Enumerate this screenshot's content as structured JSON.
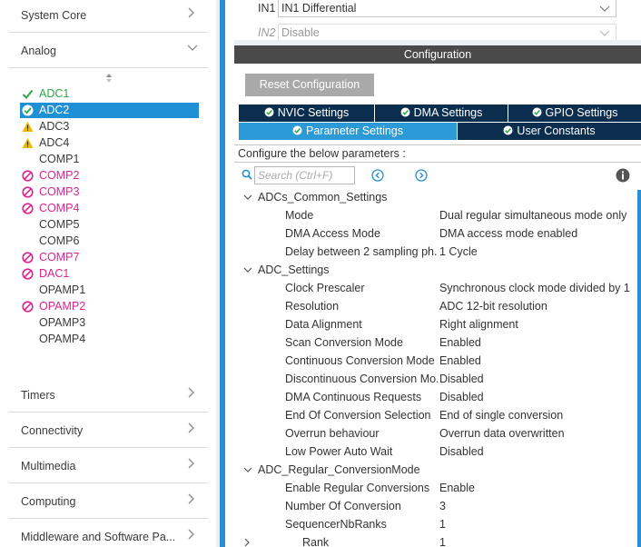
{
  "left": {
    "categories_top": [
      {
        "label": "System Core"
      },
      {
        "label": "Analog"
      }
    ],
    "peripherals": [
      {
        "name": "ADC1",
        "status": "ok",
        "color": "#2ba84a"
      },
      {
        "name": "ADC2",
        "status": "ok",
        "selected": true
      },
      {
        "name": "ADC3",
        "status": "warning"
      },
      {
        "name": "ADC4",
        "status": "warning"
      },
      {
        "name": "COMP1",
        "status": "none"
      },
      {
        "name": "COMP2",
        "status": "blocked",
        "color": "#e0228e"
      },
      {
        "name": "COMP3",
        "status": "blocked",
        "color": "#e0228e"
      },
      {
        "name": "COMP4",
        "status": "blocked",
        "color": "#e0228e"
      },
      {
        "name": "COMP5",
        "status": "none"
      },
      {
        "name": "COMP6",
        "status": "none"
      },
      {
        "name": "COMP7",
        "status": "blocked",
        "color": "#e0228e"
      },
      {
        "name": "DAC1",
        "status": "blocked",
        "color": "#e0228e"
      },
      {
        "name": "OPAMP1",
        "status": "none"
      },
      {
        "name": "OPAMP2",
        "status": "blocked",
        "color": "#e0228e"
      },
      {
        "name": "OPAMP3",
        "status": "none"
      },
      {
        "name": "OPAMP4",
        "status": "none"
      }
    ],
    "categories_bottom": [
      {
        "label": "Timers"
      },
      {
        "label": "Connectivity"
      },
      {
        "label": "Multimedia"
      },
      {
        "label": "Computing"
      },
      {
        "label": "Middleware and Software Pa..."
      }
    ]
  },
  "mode": {
    "in1": {
      "label": "IN1",
      "value": "IN1 Differential"
    },
    "in2": {
      "label": "IN2",
      "value": "Disable"
    }
  },
  "config": {
    "header": "Configuration",
    "reset_label": "Reset Configuration",
    "tabs_row1": [
      "NVIC Settings",
      "DMA Settings",
      "GPIO Settings"
    ],
    "tabs_row2": [
      "Parameter Settings",
      "User Constants"
    ],
    "active_tab": "Parameter Settings",
    "instructions": "Configure the below parameters :",
    "search_placeholder": "Search (Ctrl+F)"
  },
  "params": [
    {
      "kind": "group",
      "name": "ADCs_Common_Settings"
    },
    {
      "kind": "param",
      "name": "Mode",
      "value": "Dual regular simultaneous mode only"
    },
    {
      "kind": "param",
      "name": "DMA Access Mode",
      "value": "DMA access mode enabled"
    },
    {
      "kind": "param",
      "name": "Delay between 2 sampling ph...",
      "value": "1 Cycle"
    },
    {
      "kind": "group",
      "name": "ADC_Settings"
    },
    {
      "kind": "param",
      "name": "Clock Prescaler",
      "value": "Synchronous clock mode divided by 1"
    },
    {
      "kind": "param",
      "name": "Resolution",
      "value": "ADC 12-bit resolution"
    },
    {
      "kind": "param",
      "name": "Data Alignment",
      "value": "Right alignment"
    },
    {
      "kind": "param",
      "name": "Scan Conversion Mode",
      "value": "Enabled"
    },
    {
      "kind": "param",
      "name": "Continuous Conversion Mode",
      "value": "Enabled"
    },
    {
      "kind": "param",
      "name": "Discontinuous Conversion Mo...",
      "value": "Disabled"
    },
    {
      "kind": "param",
      "name": "DMA Continuous Requests",
      "value": "Disabled"
    },
    {
      "kind": "param",
      "name": "End Of Conversion Selection",
      "value": "End of single conversion"
    },
    {
      "kind": "param",
      "name": "Overrun behaviour",
      "value": "Overrun data overwritten"
    },
    {
      "kind": "param",
      "name": "Low Power Auto Wait",
      "value": "Disabled"
    },
    {
      "kind": "group",
      "name": "ADC_Regular_ConversionMode"
    },
    {
      "kind": "param",
      "name": "Enable Regular Conversions",
      "value": "Enable"
    },
    {
      "kind": "param",
      "name": "Number Of Conversion",
      "value": "3"
    },
    {
      "kind": "param",
      "name": "SequencerNbRanks",
      "value": "1"
    },
    {
      "kind": "sub",
      "name": "Rank",
      "value": "1"
    }
  ],
  "colors": {
    "accent": "#2a8fd2",
    "selected": "#1f8fd6",
    "tab_dark": "#0b2e4f",
    "tab_active": "#2d9ad8",
    "ok": "#2ba84a",
    "warning": "#f2b800",
    "blocked": "#e0228e"
  }
}
